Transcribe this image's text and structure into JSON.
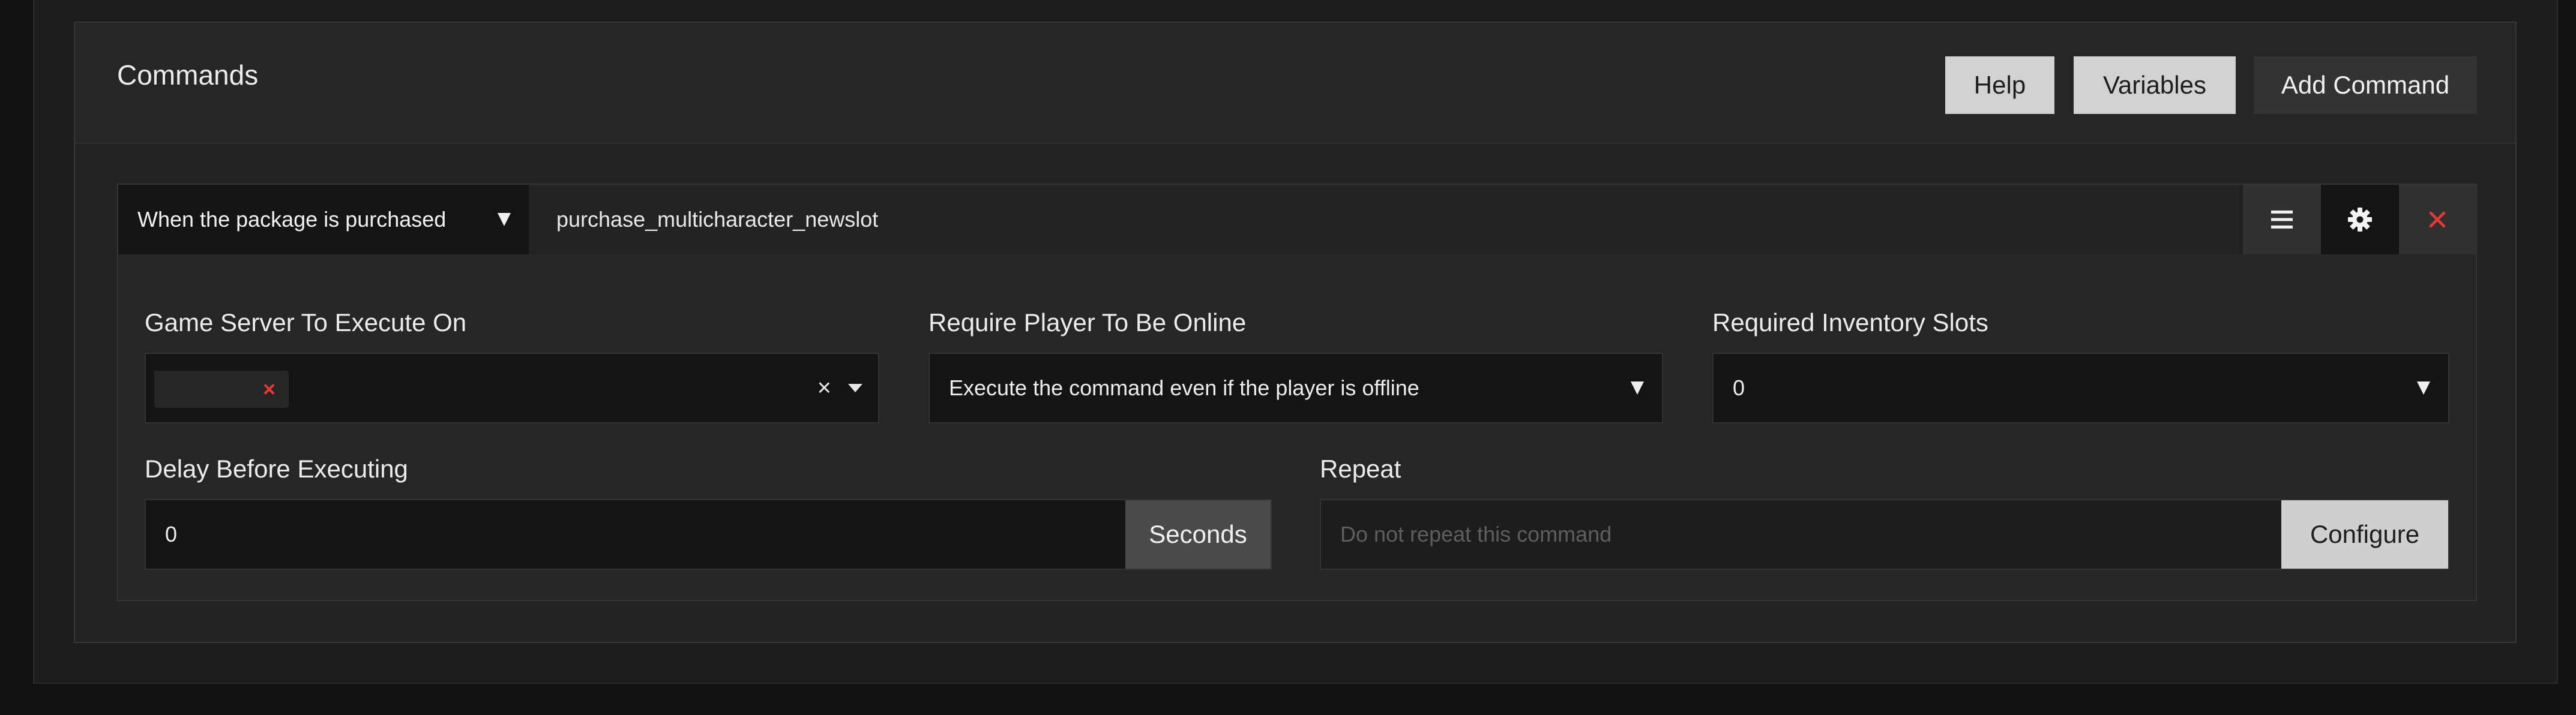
{
  "panel": {
    "title": "Commands",
    "buttons": {
      "help": "Help",
      "variables": "Variables",
      "add_command": "Add Command"
    }
  },
  "command": {
    "trigger": "When the package is purchased",
    "value": "purchase_multicharacter_newslot",
    "fields": {
      "game_server": {
        "label": "Game Server To Execute On",
        "clear": "×"
      },
      "require_online": {
        "label": "Require Player To Be Online",
        "value": "Execute the command even if the player is offline"
      },
      "inventory_slots": {
        "label": "Required Inventory Slots",
        "value": "0"
      },
      "delay": {
        "label": "Delay Before Executing",
        "value": "0",
        "unit": "Seconds"
      },
      "repeat": {
        "label": "Repeat",
        "placeholder": "Do not repeat this command",
        "button": "Configure"
      }
    }
  },
  "colors": {
    "remove_red": "#e53935",
    "active_icon_bg": "#141414"
  },
  "icons": {
    "menu": "hamburger-icon",
    "settings": "gear-icon",
    "remove": "close-icon",
    "tag_remove": "close-icon"
  }
}
